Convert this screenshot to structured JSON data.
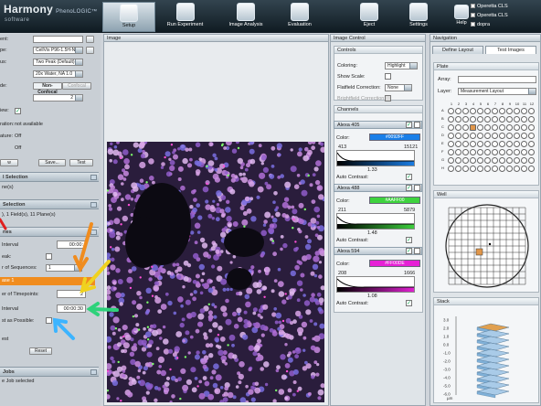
{
  "app": {
    "brand": "Harmony",
    "brand_sub": "PhenoLOGIC™",
    "brand_caption": "software"
  },
  "toolbar": {
    "items": [
      {
        "label": "Setup"
      },
      {
        "label": "Run Experiment"
      },
      {
        "label": "Image Analysis"
      },
      {
        "label": "Evaluation"
      },
      {
        "label": "Eject"
      },
      {
        "label": "Settings"
      },
      {
        "label": "Help"
      }
    ],
    "users": [
      "Operetta CLS",
      "Operetta CLS",
      "dopra"
    ]
  },
  "left": {
    "fields": [
      {
        "label": "ent:",
        "value": ""
      },
      {
        "label": "pe:",
        "value": "CellVis P96-1.5H-N"
      },
      {
        "label": "us:",
        "value": "Two Peak (Default)"
      },
      {
        "label": "",
        "value": "20x Water, NA 1.0"
      },
      {
        "label": "de:",
        "value": "Non-Confocal"
      }
    ],
    "confocal_label": "Confocal",
    "binning_value": "2",
    "preview_label": "iew:",
    "acq_label": "ration:",
    "acq_value": "not available",
    "ture_label": "ature:",
    "ture_value": "Off",
    "off2_value": "Off",
    "buttons": [
      "w",
      "Save...",
      "Test"
    ],
    "sections": [
      {
        "title": "l Selection"
      },
      {
        "title": "Selection"
      },
      {
        "title": "ries"
      }
    ],
    "well_count": "ne(s)",
    "field_text": "), 1 Field(s), 11 Plane(s)",
    "time": {
      "interval_label": "Interval",
      "interval_value": "00:00:",
      "peak_label": "eak:",
      "seq_label": "r of Sequences:",
      "seq_value": "1",
      "phase_title": "ase 1",
      "timepoints_label": "er of Timepoints:",
      "timepoints_value": "2",
      "interval2_label": "Interval",
      "interval2_value": "00:00:30",
      "fast_label": "st as Possible:",
      "test_label": "est",
      "reset_label": "Reset"
    },
    "jobs": {
      "title": "Jobs",
      "selected": "e Job selected"
    }
  },
  "image_panel": {
    "title": "Image"
  },
  "image_control": {
    "title": "Image Control",
    "controls": {
      "title": "Controls",
      "coloring_label": "Coloring:",
      "coloring_value": "Highlight",
      "scale_label": "Show Scale:",
      "flatfield_label": "Flatfield Correction:",
      "flatfield_value": "None",
      "brightfield_label": "Brightfield Correction:"
    },
    "channels_title": "Channels",
    "channels": [
      {
        "name": "Alexa 405",
        "color_label": "Color:",
        "color_hex": "#0092FF",
        "min": "413",
        "max": "15121",
        "gamma": "1.33",
        "auto_label": "Auto Contrast:",
        "swatch": "#1a7fe8"
      },
      {
        "name": "Alexa 488",
        "color_label": "Color:",
        "color_hex": "#AAFF00",
        "min": "211",
        "max": "5879",
        "gamma": "1.48",
        "auto_label": "Auto Contrast:",
        "swatch": "#3ed33e"
      },
      {
        "name": "Alexa 594",
        "color_label": "Color:",
        "color_hex": "#FF00DE",
        "min": "208",
        "max": "1666",
        "gamma": "1.08",
        "auto_label": "Auto Contrast:",
        "swatch": "#e621d6"
      }
    ]
  },
  "navigation": {
    "title": "Navigation",
    "tabs": [
      "Define Layout",
      "Test Images"
    ],
    "plate_title": "Plate",
    "array_label": "Array:",
    "layer_label": "Layer:",
    "layer_value": "Measurement Layout",
    "rows": [
      "A",
      "B",
      "C",
      "D",
      "E",
      "F",
      "G",
      "H"
    ],
    "cols": [
      "1",
      "2",
      "3",
      "4",
      "5",
      "6",
      "7",
      "8",
      "9",
      "10",
      "11",
      "12"
    ],
    "well_title": "Well",
    "stack_title": "Stack",
    "stack_ticks": [
      "3.0",
      "2.0",
      "1.0",
      "0.0",
      "-1.0",
      "-2.0",
      "-3.0",
      "-4.0",
      "-5.0",
      "-6.0"
    ],
    "stack_unit": "µm"
  },
  "colors": {
    "accent_orange": "#f08c1e",
    "arrow_yellow": "#f0d21e",
    "arrow_green": "#2ed27a",
    "arrow_blue": "#3cb4ff",
    "selected_well": "#e0964a"
  }
}
